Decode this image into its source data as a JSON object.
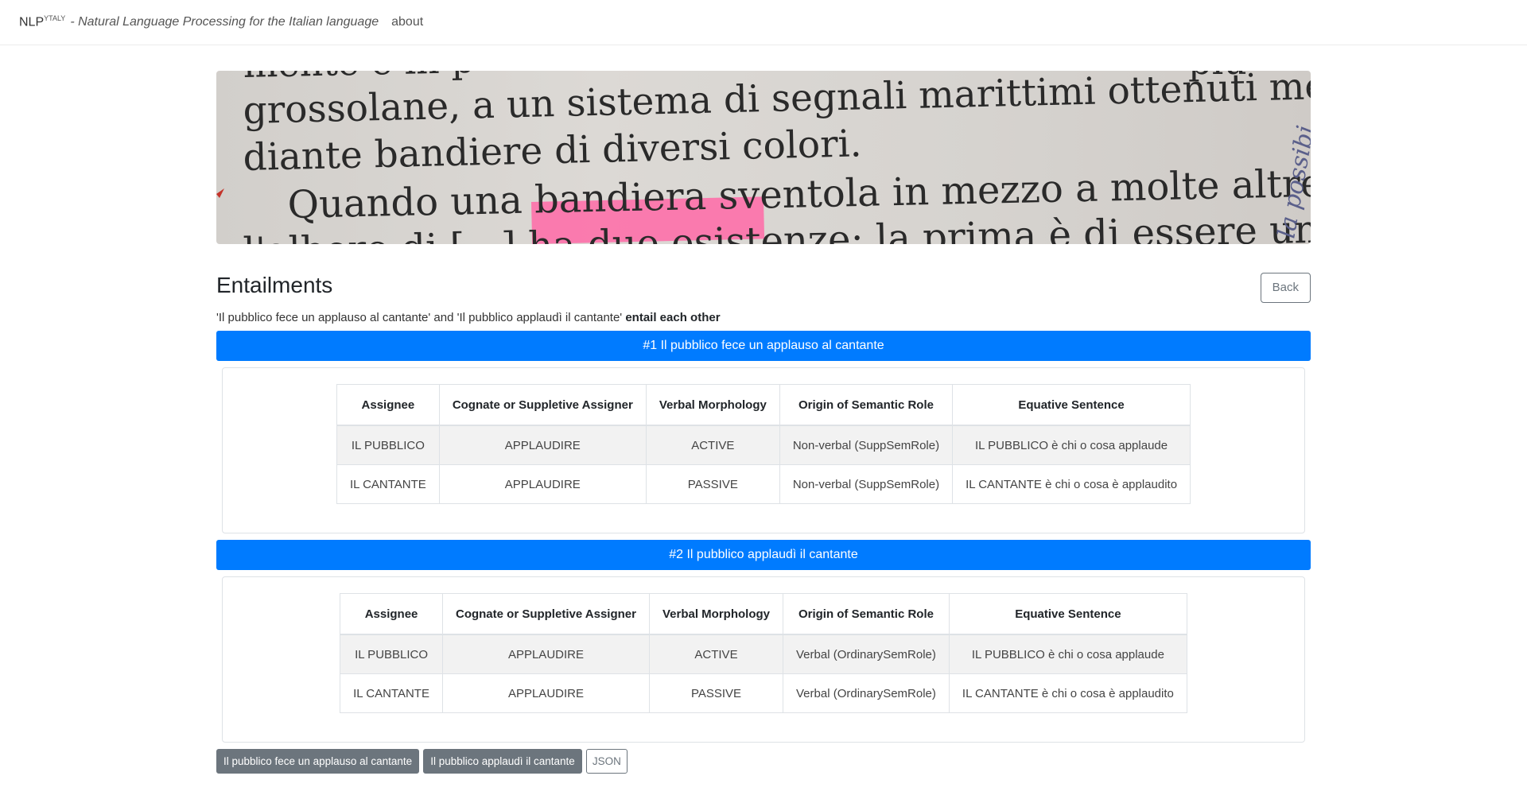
{
  "navbar": {
    "brand": "NLP",
    "brand_sup": "YTALY",
    "tagline": "- Natural Language Processing for the Italian language",
    "about_label": "about"
  },
  "banner": {
    "lines": [
      "mente e in p",
      "grossolane, a un sistema di segnali marittimi ottenuti me-",
      "diante bandiere di diversi colori.",
      "Quando una bandiera sventola in mezzo a molte altre sul-",
      "l'albero di [...] ha due esistenze; la prima è di essere un",
      "più",
      "la possibi"
    ]
  },
  "header": {
    "title": "Entailments",
    "back_label": "Back"
  },
  "summary": {
    "text": "'Il pubblico fece un applauso al cantante' and 'Il pubblico applaudì il cantante'",
    "bold": "entail each other"
  },
  "columns": [
    "Assignee",
    "Cognate or Suppletive Assigner",
    "Verbal Morphology",
    "Origin of Semantic Role",
    "Equative Sentence"
  ],
  "sentences": [
    {
      "bar_label": "#1 Il pubblico fece un applauso al cantante",
      "rows": [
        [
          "IL PUBBLICO",
          "APPLAUDIRE",
          "ACTIVE",
          "Non-verbal (SuppSemRole)",
          "IL PUBBLICO è chi o cosa applaude"
        ],
        [
          "IL CANTANTE",
          "APPLAUDIRE",
          "PASSIVE",
          "Non-verbal (SuppSemRole)",
          "IL CANTANTE è chi o cosa è applaudito"
        ]
      ]
    },
    {
      "bar_label": "#2 Il pubblico applaudì il cantante",
      "rows": [
        [
          "IL PUBBLICO",
          "APPLAUDIRE",
          "ACTIVE",
          "Verbal (OrdinarySemRole)",
          "IL PUBBLICO è chi o cosa applaude"
        ],
        [
          "IL CANTANTE",
          "APPLAUDIRE",
          "PASSIVE",
          "Verbal (OrdinarySemRole)",
          "IL CANTANTE è chi o cosa è applaudito"
        ]
      ]
    }
  ],
  "bottom_buttons": {
    "sentence1_label": "Il pubblico fece un applauso al cantante",
    "sentence2_label": "Il pubblico applaudì il cantante",
    "json_label": "JSON"
  },
  "colors": {
    "primary": "#007bff",
    "secondary": "#6c757d",
    "highlight": "#ff5fa0"
  }
}
